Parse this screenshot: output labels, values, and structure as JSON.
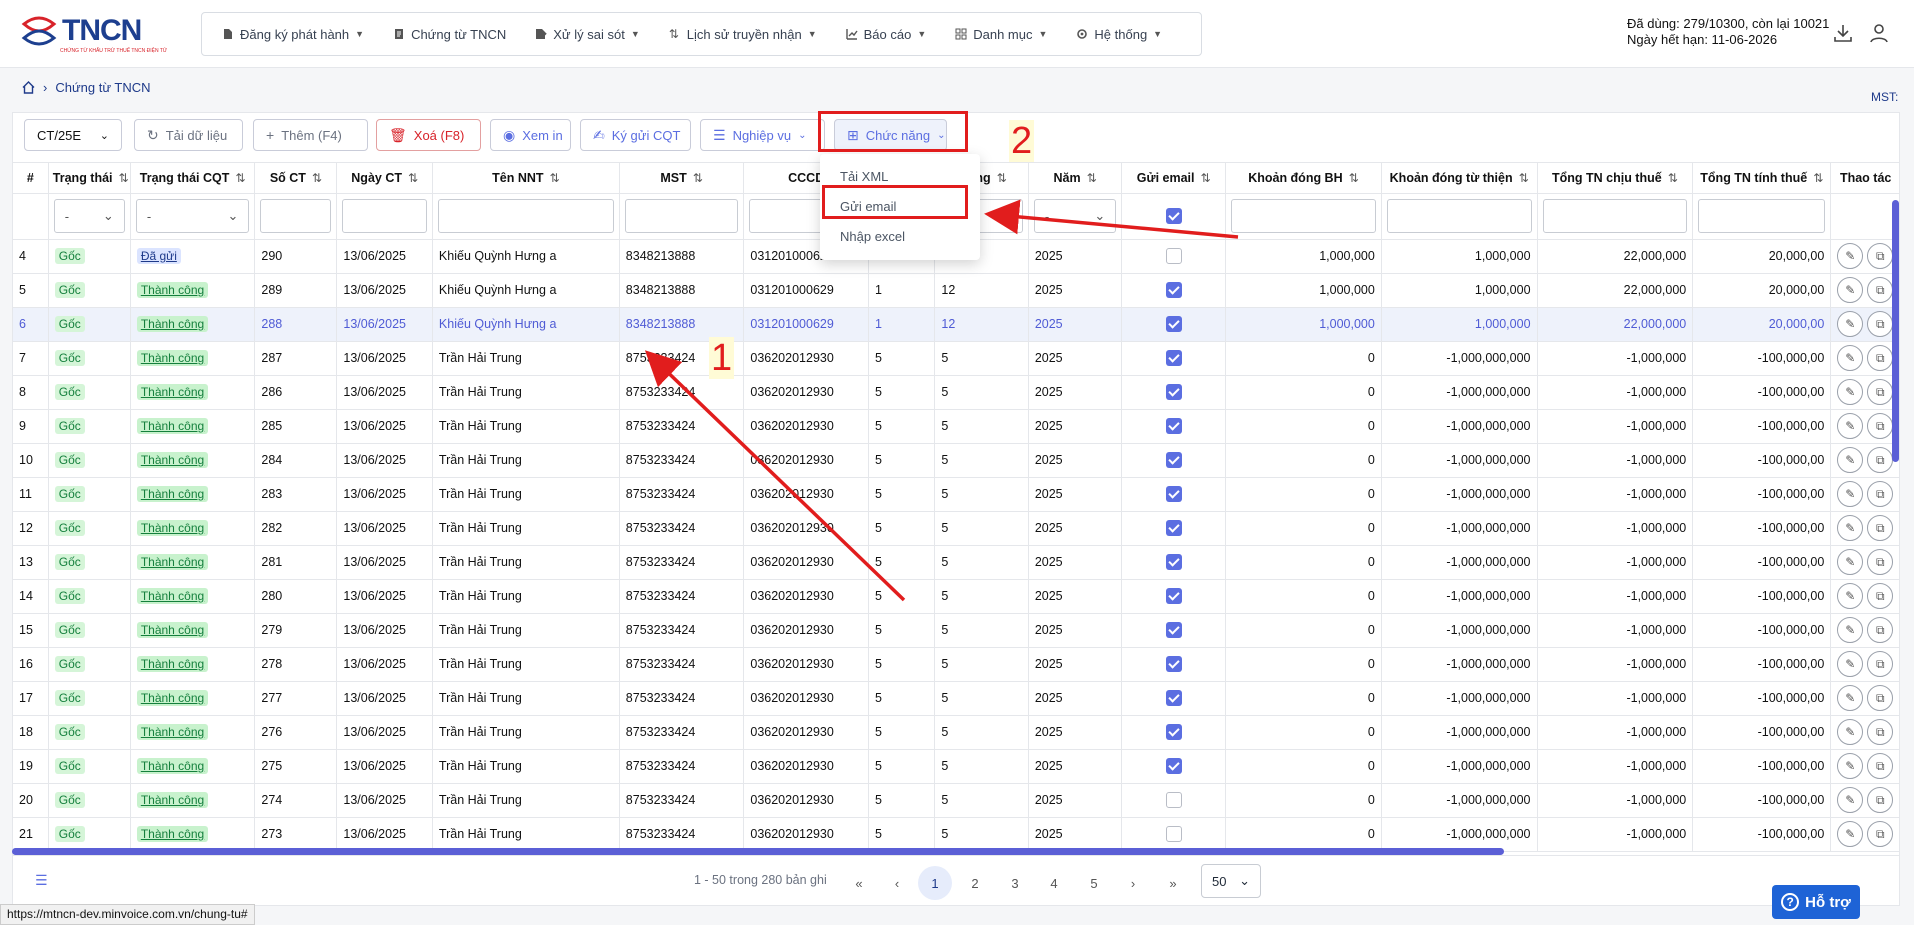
{
  "header": {
    "logo_text": "TNCN",
    "logo_tag": "CHỨNG TỪ KHẤU TRỪ THUẾ TNCN ĐIỆN TỬ",
    "nav": [
      {
        "label": "Đăng ký phát hành",
        "icon": "file-icon"
      },
      {
        "label": "Chứng từ TNCN",
        "icon": "document-icon"
      },
      {
        "label": "Xử lý sai sót",
        "icon": "file-edit-icon"
      },
      {
        "label": "Lịch sử truyền nhận",
        "icon": "swap-icon"
      },
      {
        "label": "Báo cáo",
        "icon": "chart-icon"
      },
      {
        "label": "Danh mục",
        "icon": "grid-icon"
      },
      {
        "label": "Hệ thống",
        "icon": "gear-icon"
      }
    ],
    "quota_line1": "Đã dùng: 279/10300, còn lại 10021",
    "quota_line2": "Ngày hết hạn: 11-06-2026"
  },
  "breadcrumb": {
    "home_icon": "home-icon",
    "current": "Chứng từ TNCN"
  },
  "mst_label": "MST:",
  "toolbar": {
    "form_select": "CT/25E",
    "reload": "Tải dữ liệu",
    "add": "Thêm (F4)",
    "delete": "Xoá (F8)",
    "preview": "Xem in",
    "sign_send": "Ký gửi CQT",
    "business": "Nghiệp vụ",
    "functions": "Chức năng"
  },
  "dropdown": {
    "items": [
      "Tải XML",
      "Gửi email",
      "Nhập excel"
    ]
  },
  "columns": [
    "#",
    "Trạng thái",
    "Trạng thái CQT",
    "Số CT",
    "Ngày CT",
    "Tên NNT",
    "MST",
    "CCCD",
    "",
    "tháng",
    "Năm",
    "Gửi email",
    "Khoản đóng BH",
    "Khoản đóng từ thiện",
    "Tổng TN chịu thuế",
    "Tổng TN tính thuế",
    "Thao tác"
  ],
  "filters": {
    "status": "-",
    "cqt_status": "-",
    "year": "-"
  },
  "rows": [
    {
      "no": "4",
      "status": "Gốc",
      "cqt": "Đã gửi",
      "so": "290",
      "date": "13/06/2025",
      "name": "Khiếu Quỳnh Hưng a",
      "mst": "8348213888",
      "cccd": "031201000629",
      "m1": "1",
      "m2": "12",
      "year": "2025",
      "email": false,
      "bh": "1,000,000",
      "tt": "1,000,000",
      "ct": "22,000,000",
      "tn": "20,000,00"
    },
    {
      "no": "5",
      "status": "Gốc",
      "cqt": "Thành công",
      "so": "289",
      "date": "13/06/2025",
      "name": "Khiếu Quỳnh Hưng a",
      "mst": "8348213888",
      "cccd": "031201000629",
      "m1": "1",
      "m2": "12",
      "year": "2025",
      "email": true,
      "bh": "1,000,000",
      "tt": "1,000,000",
      "ct": "22,000,000",
      "tn": "20,000,00"
    },
    {
      "no": "6",
      "status": "Gốc",
      "cqt": "Thành công",
      "so": "288",
      "date": "13/06/2025",
      "name": "Khiếu Quỳnh Hưng a",
      "mst": "8348213888",
      "cccd": "031201000629",
      "m1": "1",
      "m2": "12",
      "year": "2025",
      "email": true,
      "bh": "1,000,000",
      "tt": "1,000,000",
      "ct": "22,000,000",
      "tn": "20,000,00",
      "selected": true
    },
    {
      "no": "7",
      "status": "Gốc",
      "cqt": "Thành công",
      "so": "287",
      "date": "13/06/2025",
      "name": "Trần Hải Trung",
      "mst": "8753233424",
      "cccd": "036202012930",
      "m1": "5",
      "m2": "5",
      "year": "2025",
      "email": true,
      "bh": "0",
      "tt": "-1,000,000,000",
      "ct": "-1,000,000",
      "tn": "-100,000,00"
    },
    {
      "no": "8",
      "status": "Gốc",
      "cqt": "Thành công",
      "so": "286",
      "date": "13/06/2025",
      "name": "Trần Hải Trung",
      "mst": "8753233424",
      "cccd": "036202012930",
      "m1": "5",
      "m2": "5",
      "year": "2025",
      "email": true,
      "bh": "0",
      "tt": "-1,000,000,000",
      "ct": "-1,000,000",
      "tn": "-100,000,00"
    },
    {
      "no": "9",
      "status": "Gốc",
      "cqt": "Thành công",
      "so": "285",
      "date": "13/06/2025",
      "name": "Trần Hải Trung",
      "mst": "8753233424",
      "cccd": "036202012930",
      "m1": "5",
      "m2": "5",
      "year": "2025",
      "email": true,
      "bh": "0",
      "tt": "-1,000,000,000",
      "ct": "-1,000,000",
      "tn": "-100,000,00"
    },
    {
      "no": "10",
      "status": "Gốc",
      "cqt": "Thành công",
      "so": "284",
      "date": "13/06/2025",
      "name": "Trần Hải Trung",
      "mst": "8753233424",
      "cccd": "036202012930",
      "m1": "5",
      "m2": "5",
      "year": "2025",
      "email": true,
      "bh": "0",
      "tt": "-1,000,000,000",
      "ct": "-1,000,000",
      "tn": "-100,000,00"
    },
    {
      "no": "11",
      "status": "Gốc",
      "cqt": "Thành công",
      "so": "283",
      "date": "13/06/2025",
      "name": "Trần Hải Trung",
      "mst": "8753233424",
      "cccd": "036202012930",
      "m1": "5",
      "m2": "5",
      "year": "2025",
      "email": true,
      "bh": "0",
      "tt": "-1,000,000,000",
      "ct": "-1,000,000",
      "tn": "-100,000,00"
    },
    {
      "no": "12",
      "status": "Gốc",
      "cqt": "Thành công",
      "so": "282",
      "date": "13/06/2025",
      "name": "Trần Hải Trung",
      "mst": "8753233424",
      "cccd": "036202012930",
      "m1": "5",
      "m2": "5",
      "year": "2025",
      "email": true,
      "bh": "0",
      "tt": "-1,000,000,000",
      "ct": "-1,000,000",
      "tn": "-100,000,00"
    },
    {
      "no": "13",
      "status": "Gốc",
      "cqt": "Thành công",
      "so": "281",
      "date": "13/06/2025",
      "name": "Trần Hải Trung",
      "mst": "8753233424",
      "cccd": "036202012930",
      "m1": "5",
      "m2": "5",
      "year": "2025",
      "email": true,
      "bh": "0",
      "tt": "-1,000,000,000",
      "ct": "-1,000,000",
      "tn": "-100,000,00"
    },
    {
      "no": "14",
      "status": "Gốc",
      "cqt": "Thành công",
      "so": "280",
      "date": "13/06/2025",
      "name": "Trần Hải Trung",
      "mst": "8753233424",
      "cccd": "036202012930",
      "m1": "5",
      "m2": "5",
      "year": "2025",
      "email": true,
      "bh": "0",
      "tt": "-1,000,000,000",
      "ct": "-1,000,000",
      "tn": "-100,000,00"
    },
    {
      "no": "15",
      "status": "Gốc",
      "cqt": "Thành công",
      "so": "279",
      "date": "13/06/2025",
      "name": "Trần Hải Trung",
      "mst": "8753233424",
      "cccd": "036202012930",
      "m1": "5",
      "m2": "5",
      "year": "2025",
      "email": true,
      "bh": "0",
      "tt": "-1,000,000,000",
      "ct": "-1,000,000",
      "tn": "-100,000,00"
    },
    {
      "no": "16",
      "status": "Gốc",
      "cqt": "Thành công",
      "so": "278",
      "date": "13/06/2025",
      "name": "Trần Hải Trung",
      "mst": "8753233424",
      "cccd": "036202012930",
      "m1": "5",
      "m2": "5",
      "year": "2025",
      "email": true,
      "bh": "0",
      "tt": "-1,000,000,000",
      "ct": "-1,000,000",
      "tn": "-100,000,00"
    },
    {
      "no": "17",
      "status": "Gốc",
      "cqt": "Thành công",
      "so": "277",
      "date": "13/06/2025",
      "name": "Trần Hải Trung",
      "mst": "8753233424",
      "cccd": "036202012930",
      "m1": "5",
      "m2": "5",
      "year": "2025",
      "email": true,
      "bh": "0",
      "tt": "-1,000,000,000",
      "ct": "-1,000,000",
      "tn": "-100,000,00"
    },
    {
      "no": "18",
      "status": "Gốc",
      "cqt": "Thành công",
      "so": "276",
      "date": "13/06/2025",
      "name": "Trần Hải Trung",
      "mst": "8753233424",
      "cccd": "036202012930",
      "m1": "5",
      "m2": "5",
      "year": "2025",
      "email": true,
      "bh": "0",
      "tt": "-1,000,000,000",
      "ct": "-1,000,000",
      "tn": "-100,000,00"
    },
    {
      "no": "19",
      "status": "Gốc",
      "cqt": "Thành công",
      "so": "275",
      "date": "13/06/2025",
      "name": "Trần Hải Trung",
      "mst": "8753233424",
      "cccd": "036202012930",
      "m1": "5",
      "m2": "5",
      "year": "2025",
      "email": true,
      "bh": "0",
      "tt": "-1,000,000,000",
      "ct": "-1,000,000",
      "tn": "-100,000,00"
    },
    {
      "no": "20",
      "status": "Gốc",
      "cqt": "Thành công",
      "so": "274",
      "date": "13/06/2025",
      "name": "Trần Hải Trung",
      "mst": "8753233424",
      "cccd": "036202012930",
      "m1": "5",
      "m2": "5",
      "year": "2025",
      "email": false,
      "bh": "0",
      "tt": "-1,000,000,000",
      "ct": "-1,000,000",
      "tn": "-100,000,00"
    },
    {
      "no": "21",
      "status": "Gốc",
      "cqt": "Thành công",
      "so": "273",
      "date": "13/06/2025",
      "name": "Trần Hải Trung",
      "mst": "8753233424",
      "cccd": "036202012930",
      "m1": "5",
      "m2": "5",
      "year": "2025",
      "email": false,
      "bh": "0",
      "tt": "-1,000,000,000",
      "ct": "-1,000,000",
      "tn": "-100,000,00"
    }
  ],
  "pager": {
    "summary": "1 - 50 trong 280 bản ghi",
    "pages": [
      "1",
      "2",
      "3",
      "4",
      "5"
    ],
    "current": "1",
    "page_size": "50"
  },
  "status_url": "https://mtncn-dev.minvoice.com.vn/chung-tu#",
  "support": "Hỗ trợ",
  "annotations": {
    "step1": "1",
    "step2": "2",
    "color": "#e11d1d"
  },
  "colors": {
    "accent": "#5b6ee1",
    "brand": "#1d3f8f",
    "success_bg": "#c8f2cd",
    "danger": "#d8232a"
  }
}
